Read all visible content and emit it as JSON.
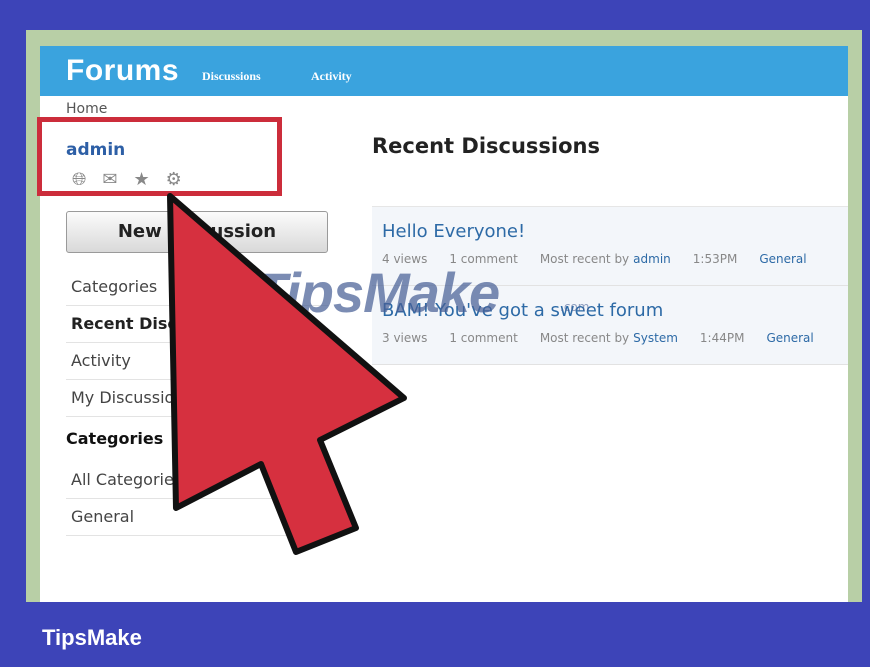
{
  "header": {
    "brand": "Forums",
    "nav": [
      "Discussions",
      "Activity"
    ]
  },
  "breadcrumb": "Home",
  "user": {
    "name": "admin",
    "icons": [
      "globe-icon",
      "mail-icon",
      "star-icon",
      "gear-icon"
    ]
  },
  "sidebar": {
    "new_button": "New Discussion",
    "items": [
      "Categories",
      "Recent Discussions",
      "Activity",
      "My Discussions"
    ],
    "active_item": "Recent Discussions",
    "categories_heading": "Categories",
    "categories": [
      "All Categories",
      "General"
    ]
  },
  "main": {
    "heading": "Recent Discussions",
    "discussions": [
      {
        "title": "Hello Everyone!",
        "views": "4 views",
        "comments": "1 comment",
        "most_recent": "Most recent by",
        "author": "admin",
        "time": "1:53PM",
        "category": "General"
      },
      {
        "title": "BAM! You've got a sweet forum",
        "views": "3 views",
        "comments": "1 comment",
        "most_recent": "Most recent by",
        "author": "System",
        "time": "1:44PM",
        "category": "General"
      }
    ]
  },
  "watermark": {
    "text": "TipsMake",
    "sub": ".com"
  },
  "footer": {
    "label": "TipsMake"
  },
  "colors": {
    "header": "#3aa3de",
    "highlight": "#cc2d3b",
    "arrow": "#d6303f",
    "background": "#3d44b8"
  }
}
